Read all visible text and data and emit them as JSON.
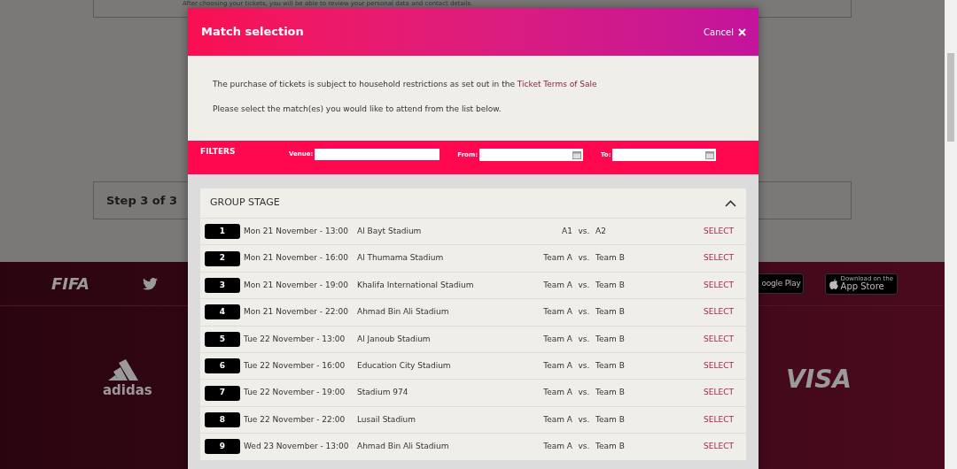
{
  "background_page": {
    "step_2_description": "After choosing your tickets, you will be able to review your personal data and contact details.",
    "step_3_label": "Step 3 of 3",
    "footer": {
      "fifa_logo": "FIFA",
      "google_play_badge": "oogle Play",
      "app_store_badge": {
        "caption": "Download on the",
        "label": "App Store"
      },
      "sponsors": [
        "adidas",
        "VISA"
      ]
    }
  },
  "modal": {
    "title": "Match selection",
    "cancel": "Cancel",
    "intro": "The purchase of tickets is subject to household restrictions as set out in the",
    "terms_link": "Ticket Terms of Sale",
    "instruction": "Please select the match(es) you would like to attend from the list below.",
    "filters": {
      "title": "FILTERS",
      "venue_label": "Venue:",
      "from_label": "From:",
      "to_label": "To:"
    },
    "group": {
      "title": "GROUP STAGE",
      "expanded": true,
      "matches": [
        {
          "number": "1",
          "datetime": "Mon 21 November - 13:00",
          "venue": "Al Bayt Stadium",
          "home": "A1",
          "vs": "vs.",
          "away": "A2",
          "action": "SELECT"
        },
        {
          "number": "2",
          "datetime": "Mon 21 November - 16:00",
          "venue": "Al Thumama Stadium",
          "home": "Team A",
          "vs": "vs.",
          "away": "Team B",
          "action": "SELECT"
        },
        {
          "number": "3",
          "datetime": "Mon 21 November - 19:00",
          "venue": "Khalifa International Stadium",
          "home": "Team A",
          "vs": "vs.",
          "away": "Team B",
          "action": "SELECT"
        },
        {
          "number": "4",
          "datetime": "Mon 21 November - 22:00",
          "venue": "Ahmad Bin Ali Stadium",
          "home": "Team A",
          "vs": "vs.",
          "away": "Team B",
          "action": "SELECT"
        },
        {
          "number": "5",
          "datetime": "Tue 22 November - 13:00",
          "venue": "Al Janoub Stadium",
          "home": "Team A",
          "vs": "vs.",
          "away": "Team B",
          "action": "SELECT"
        },
        {
          "number": "6",
          "datetime": "Tue 22 November - 16:00",
          "venue": "Education City Stadium",
          "home": "Team A",
          "vs": "vs.",
          "away": "Team B",
          "action": "SELECT"
        },
        {
          "number": "7",
          "datetime": "Tue 22 November - 19:00",
          "venue": "Stadium 974",
          "home": "Team A",
          "vs": "vs.",
          "away": "Team B",
          "action": "SELECT"
        },
        {
          "number": "8",
          "datetime": "Tue 22 November - 22:00",
          "venue": "Lusail Stadium",
          "home": "Team A",
          "vs": "vs.",
          "away": "Team B",
          "action": "SELECT"
        },
        {
          "number": "9",
          "datetime": "Wed 23 November - 13:00",
          "venue": "Ahmad Bin Ali Stadium",
          "home": "Team A",
          "vs": "vs.",
          "away": "Team B",
          "action": "SELECT"
        }
      ]
    }
  }
}
